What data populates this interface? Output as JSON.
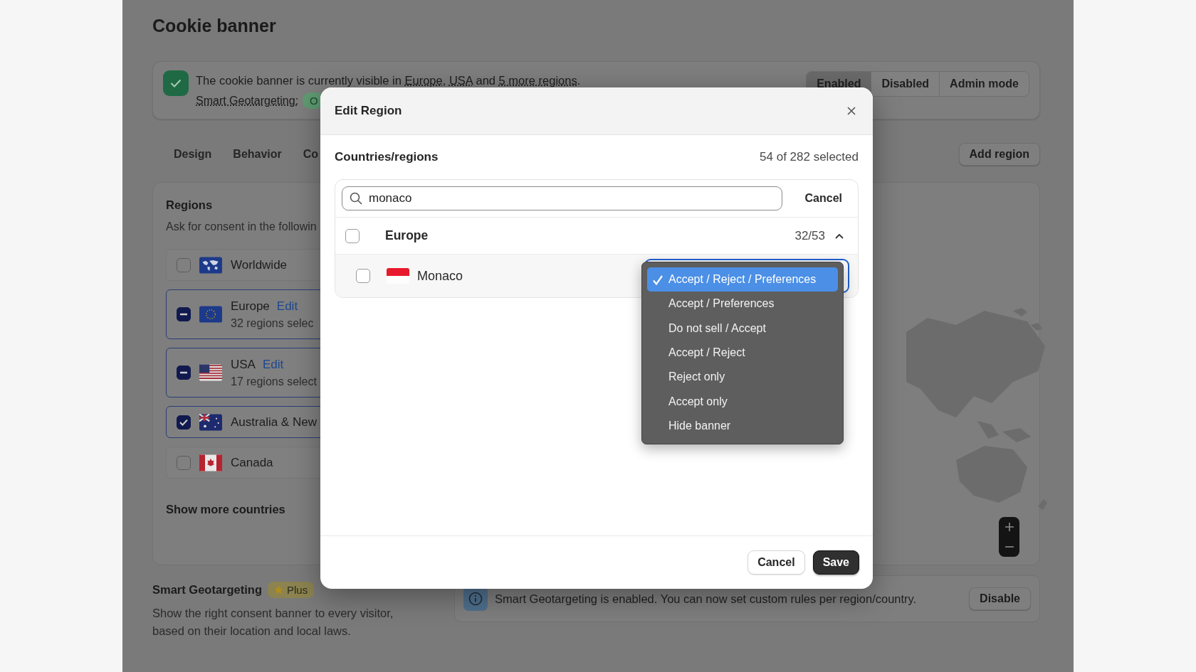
{
  "page": {
    "title": "Cookie banner"
  },
  "status": {
    "parts": [
      {
        "before": "The cookie banner is currently visible in ",
        "link": "Europe"
      },
      {
        "before": ", ",
        "link": "USA"
      },
      {
        "before": " and ",
        "link": "5 more regions"
      }
    ],
    "end": ".",
    "geotargeting_label": "Smart Geotargeting:",
    "geotargeting_badge": "O",
    "modes": [
      {
        "label": "Enabled",
        "selected": true
      },
      {
        "label": "Disabled",
        "selected": false
      },
      {
        "label": "Admin mode",
        "selected": false
      }
    ]
  },
  "tabs": [
    {
      "label": "Design"
    },
    {
      "label": "Behavior"
    },
    {
      "label": "Co"
    }
  ],
  "add_region_button": "Add region",
  "regions": {
    "title": "Regions",
    "description": "Ask for consent in the followin",
    "show_more": "Show more countries",
    "items": [
      {
        "name": "Worldwide",
        "checked": false,
        "partial": false
      },
      {
        "name": "Europe",
        "edit": "Edit",
        "detail": "32 regions selec",
        "checked": false,
        "partial": true
      },
      {
        "name": "USA",
        "edit": "Edit",
        "detail": "17 regions select",
        "checked": false,
        "partial": true
      },
      {
        "name": "Australia & New",
        "checked": true,
        "partial": false
      },
      {
        "name": "Canada",
        "checked": false,
        "partial": false
      }
    ]
  },
  "smart_geotargeting": {
    "title": "Smart Geotargeting",
    "badge": "Plus",
    "description": "Show the right consent banner to every visitor, based on their location and local laws.",
    "notice": "Smart Geotargeting is enabled. You can now set custom rules per region/country.",
    "disable_button": "Disable"
  },
  "modal": {
    "title": "Edit Region",
    "section_label": "Countries/regions",
    "selection_count": "54 of 282 selected",
    "search": {
      "value": "monaco"
    },
    "search_cancel": "Cancel",
    "group": {
      "name": "Europe",
      "count": "32/53",
      "expanded": true,
      "checked": false
    },
    "countries": [
      {
        "name": "Monaco",
        "checked": false
      }
    ],
    "options": [
      {
        "label": "Accept / Reject / Preferences",
        "selected": true
      },
      {
        "label": "Accept / Preferences",
        "selected": false
      },
      {
        "label": "Do not sell / Accept",
        "selected": false
      },
      {
        "label": "Accept / Reject",
        "selected": false
      },
      {
        "label": "Reject only",
        "selected": false
      },
      {
        "label": "Accept only",
        "selected": false
      },
      {
        "label": "Hide banner",
        "selected": false
      }
    ],
    "cancel_button": "Cancel",
    "save_button": "Save"
  }
}
